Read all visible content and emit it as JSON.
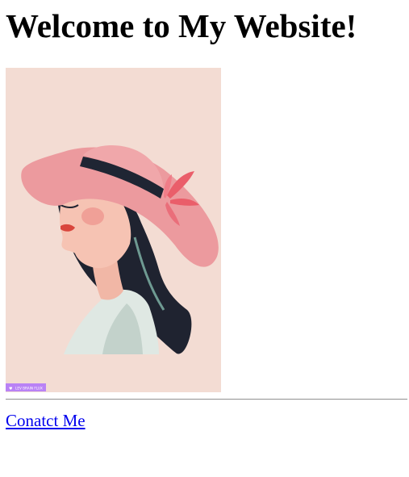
{
  "page": {
    "heading": "Welcome to My Website!",
    "image": {
      "description_icon": "woman-in-pink-hat-illustration",
      "badge_text": "LEV BRAIN FLUX"
    },
    "contact_link": "Conatct Me"
  },
  "colors": {
    "link": "#0000ee",
    "image_background": "#f2dbd2",
    "hat": "#ec9a9e",
    "hat_band": "#1f2533",
    "hair": "#1e2230",
    "shirt": "#dfe7e2",
    "badge": "#b982f5"
  }
}
